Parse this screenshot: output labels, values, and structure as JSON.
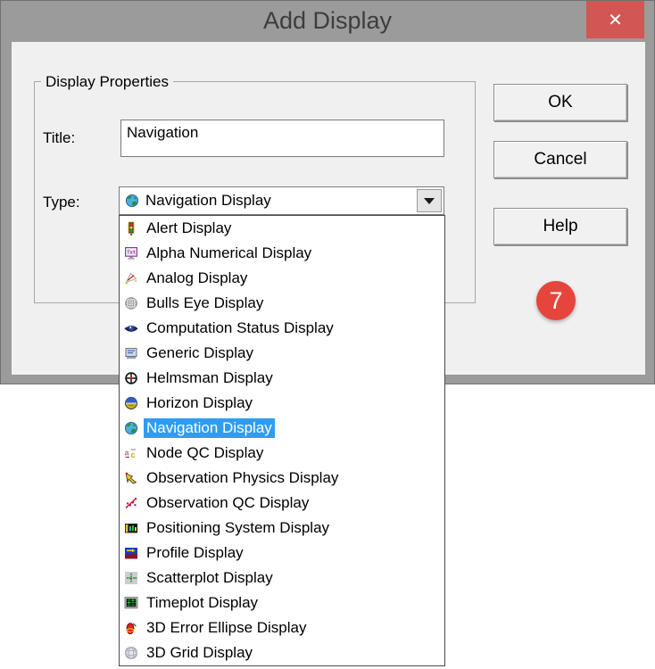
{
  "dialog": {
    "title": "Add Display",
    "close_glyph": "✕"
  },
  "group": {
    "legend": "Display Properties"
  },
  "fields": {
    "title_label": "Title:",
    "title_value": "Navigation",
    "type_label": "Type:",
    "type_value": "Navigation Display",
    "type_icon": "globe-icon"
  },
  "buttons": {
    "ok": "OK",
    "cancel": "Cancel",
    "help": "Help"
  },
  "annotation": {
    "step_number": "7",
    "color": "#e6453c"
  },
  "colors": {
    "selection": "#2f9cf3",
    "titlebar": "#9b9b9b",
    "close_red": "#d25652",
    "panel": "#f0f0f0"
  },
  "dropdown": {
    "selected_index": 8,
    "items": [
      {
        "label": "Alert Display",
        "icon": "traffic-light-icon"
      },
      {
        "label": "Alpha Numerical Display",
        "icon": "alpha-monitor-icon"
      },
      {
        "label": "Analog Display",
        "icon": "analog-gauge-icon"
      },
      {
        "label": "Bulls Eye Display",
        "icon": "bullseye-icon"
      },
      {
        "label": "Computation Status Display",
        "icon": "computation-eye-icon"
      },
      {
        "label": "Generic Display",
        "icon": "generic-monitor-icon"
      },
      {
        "label": "Helmsman Display",
        "icon": "helm-wheel-icon"
      },
      {
        "label": "Horizon Display",
        "icon": "horizon-icon"
      },
      {
        "label": "Navigation Display",
        "icon": "globe-icon"
      },
      {
        "label": "Node QC Display",
        "icon": "node-qc-icon"
      },
      {
        "label": "Observation Physics Display",
        "icon": "physics-hand-icon"
      },
      {
        "label": "Observation QC Display",
        "icon": "observation-qc-icon"
      },
      {
        "label": "Positioning System Display",
        "icon": "positioning-bars-icon"
      },
      {
        "label": "Profile Display",
        "icon": "profile-area-icon"
      },
      {
        "label": "Scatterplot Display",
        "icon": "scatterplot-icon"
      },
      {
        "label": "Timeplot Display",
        "icon": "timeplot-grid-icon"
      },
      {
        "label": "3D Error Ellipse Display",
        "icon": "error-ellipse-icon"
      },
      {
        "label": "3D Grid Display",
        "icon": "grid-sphere-icon"
      }
    ]
  }
}
